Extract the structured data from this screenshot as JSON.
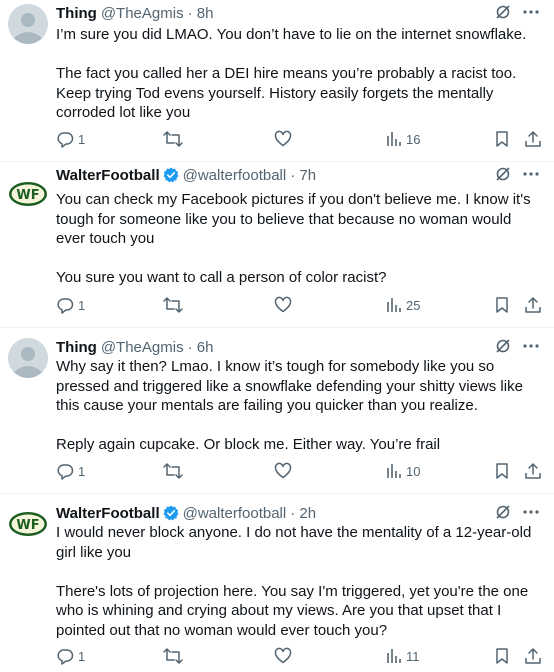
{
  "tweets": [
    {
      "name": "Thing",
      "handle": "@TheAgmis",
      "time": "· 8h",
      "verified": false,
      "avatar": "grey-default-avatar",
      "text": "I’m sure you did LMAO. You don’t have to lie on the internet snowflake.\n\nThe fact you called her a DEI hire means you’re probably a racist too. Keep trying Tod evens yourself. History easily forgets the mentally corroded lot like you",
      "replies": "1",
      "views": "16"
    },
    {
      "name": "WalterFootball",
      "handle": "@walterfootball",
      "time": "· 7h",
      "verified": true,
      "avatar": "WF",
      "text": "You can check my Facebook pictures if you don't believe me. I know it's tough for someone like you to believe that because no woman would ever touch you\n\nYou sure you want to call a person of color racist?",
      "replies": "1",
      "views": "25"
    },
    {
      "name": "Thing",
      "handle": "@TheAgmis",
      "time": "· 6h",
      "verified": false,
      "avatar": "grey-default-avatar",
      "text": "Why say it then? Lmao. I know it’s tough for somebody like you so pressed and triggered like a snowflake defending your shitty views like this cause your mentals are failing you quicker than you realize.\n\nReply again cupcake. Or block me. Either way. You’re frail",
      "replies": "1",
      "views": "10"
    },
    {
      "name": "WalterFootball",
      "handle": "@walterfootball",
      "time": "· 2h",
      "verified": true,
      "avatar": "WF",
      "text": "I would never block anyone. I do not have the mentality of a 12-year-old girl like you\n\nThere's lots of projection here. You say I'm triggered, yet you're the one who is whining and crying about my views. Are you that upset that I pointed out that no woman would ever touch you?",
      "replies": "1",
      "views": "11"
    }
  ],
  "icons": {
    "grok": "grok-icon",
    "more": "more-icon",
    "reply": "reply-icon",
    "repost": "repost-icon",
    "like": "like-icon",
    "views": "views-icon",
    "bookmark": "bookmark-icon",
    "share": "share-icon"
  },
  "colors": {
    "text": "#0f1419",
    "secondary": "#536471",
    "verified_blue": "#1d9bf0",
    "wf_green": "#2e7d32",
    "divider": "#eff3f4"
  }
}
